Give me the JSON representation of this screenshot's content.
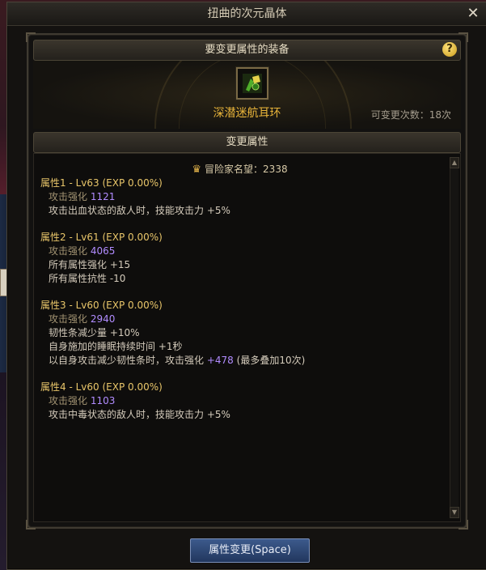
{
  "window": {
    "title": "扭曲的次元晶体",
    "close_glyph": "✕"
  },
  "equip_section": {
    "header": "要变更属性的装备",
    "help_glyph": "?",
    "item_name": "深潜迷航耳环",
    "change_count": "可变更次数：18次"
  },
  "attr_section": {
    "header": "变更属性",
    "reputation": "冒险家名望：2338",
    "blocks": [
      {
        "title": "属性1 - Lv63 (EXP 0.00%)",
        "attack_label": "攻击强化",
        "attack_value": "1121",
        "lines": [
          "攻击出血状态的敌人时，技能攻击力 +5%"
        ]
      },
      {
        "title": "属性2 - Lv61 (EXP 0.00%)",
        "attack_label": "攻击强化",
        "attack_value": "4065",
        "lines": [
          "所有属性强化 +15",
          "所有属性抗性 -10"
        ]
      },
      {
        "title": "属性3 - Lv60 (EXP 0.00%)",
        "attack_label": "攻击强化",
        "attack_value": "2940",
        "lines": [
          "韧性条减少量 +10%",
          "自身施加的睡眠持续时间 +1秒"
        ],
        "extra_prefix": "以自身攻击减少韧性条时，攻击强化",
        "extra_value": "+478",
        "extra_suffix": "(最多叠加10次)"
      },
      {
        "title": "属性4 - Lv60 (EXP 0.00%)",
        "attack_label": "攻击强化",
        "attack_value": "1103",
        "lines": [
          "攻击中毒状态的敌人时，技能攻击力 +5%"
        ]
      }
    ]
  },
  "footer": {
    "button_label": "属性变更(Space)"
  },
  "colors": {
    "gold": "#e9c66a",
    "purple": "#b18cff",
    "button_blue": "#2e4a7a"
  }
}
